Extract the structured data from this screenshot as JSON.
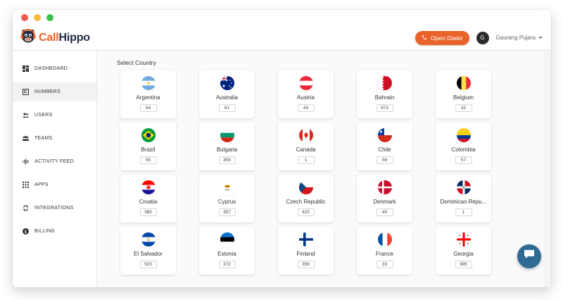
{
  "window": {
    "controls": {
      "close_color": "#f15b51",
      "minimize_color": "#f7bd36",
      "maximize_color": "#3fc24d"
    }
  },
  "header": {
    "brand": {
      "part1": "Call",
      "part2": "Hippo"
    },
    "dialer_label": "Open Dialer",
    "avatar_initial": "G",
    "username": "Gaurang Pujara",
    "accent_color": "#e9622a"
  },
  "sidebar": {
    "items": [
      {
        "label": "DASHBOARD",
        "icon": "dashboard-icon"
      },
      {
        "label": "NUMBERS",
        "icon": "numbers-icon",
        "active": true
      },
      {
        "label": "USERS",
        "icon": "users-icon"
      },
      {
        "label": "TEAMS",
        "icon": "teams-icon"
      },
      {
        "label": "ACTIVITY FEED",
        "icon": "activity-icon"
      },
      {
        "label": "APPS",
        "icon": "apps-icon"
      },
      {
        "label": "INTEGRATIONS",
        "icon": "integrations-icon"
      },
      {
        "label": "BILLING",
        "icon": "billing-icon"
      }
    ]
  },
  "main": {
    "title": "Select Country",
    "countries": [
      {
        "name": "Argentina",
        "count": "54",
        "flag": "argentina-flag-icon"
      },
      {
        "name": "Australia",
        "count": "61",
        "flag": "australia-flag-icon"
      },
      {
        "name": "Austria",
        "count": "43",
        "flag": "austria-flag-icon"
      },
      {
        "name": "Bahrain",
        "count": "973",
        "flag": "bahrain-flag-icon"
      },
      {
        "name": "Belgium",
        "count": "32",
        "flag": "belgium-flag-icon"
      },
      {
        "name": "Brazil",
        "count": "55",
        "flag": "brazil-flag-icon"
      },
      {
        "name": "Bulgaria",
        "count": "359",
        "flag": "bulgaria-flag-icon"
      },
      {
        "name": "Canada",
        "count": "1",
        "flag": "canada-flag-icon"
      },
      {
        "name": "Chile",
        "count": "56",
        "flag": "chile-flag-icon"
      },
      {
        "name": "Colombia",
        "count": "57",
        "flag": "colombia-flag-icon"
      },
      {
        "name": "Croatia",
        "count": "385",
        "flag": "croatia-flag-icon"
      },
      {
        "name": "Cyprus",
        "count": "357",
        "flag": "cyprus-flag-icon"
      },
      {
        "name": "Czech Republic",
        "count": "420",
        "flag": "czech-republic-flag-icon"
      },
      {
        "name": "Denmark",
        "count": "45",
        "flag": "denmark-flag-icon"
      },
      {
        "name": "Dominican Repu...",
        "count": "1",
        "flag": "dominican-republic-flag-icon"
      },
      {
        "name": "El Salvador",
        "count": "503",
        "flag": "el-salvador-flag-icon"
      },
      {
        "name": "Estonia",
        "count": "372",
        "flag": "estonia-flag-icon"
      },
      {
        "name": "Finland",
        "count": "358",
        "flag": "finland-flag-icon"
      },
      {
        "name": "France",
        "count": "33",
        "flag": "france-flag-icon"
      },
      {
        "name": "Georgia",
        "count": "995",
        "flag": "georgia-flag-icon"
      }
    ]
  },
  "chat": {
    "icon": "chat-bubble-icon",
    "color": "#2f6a93"
  }
}
